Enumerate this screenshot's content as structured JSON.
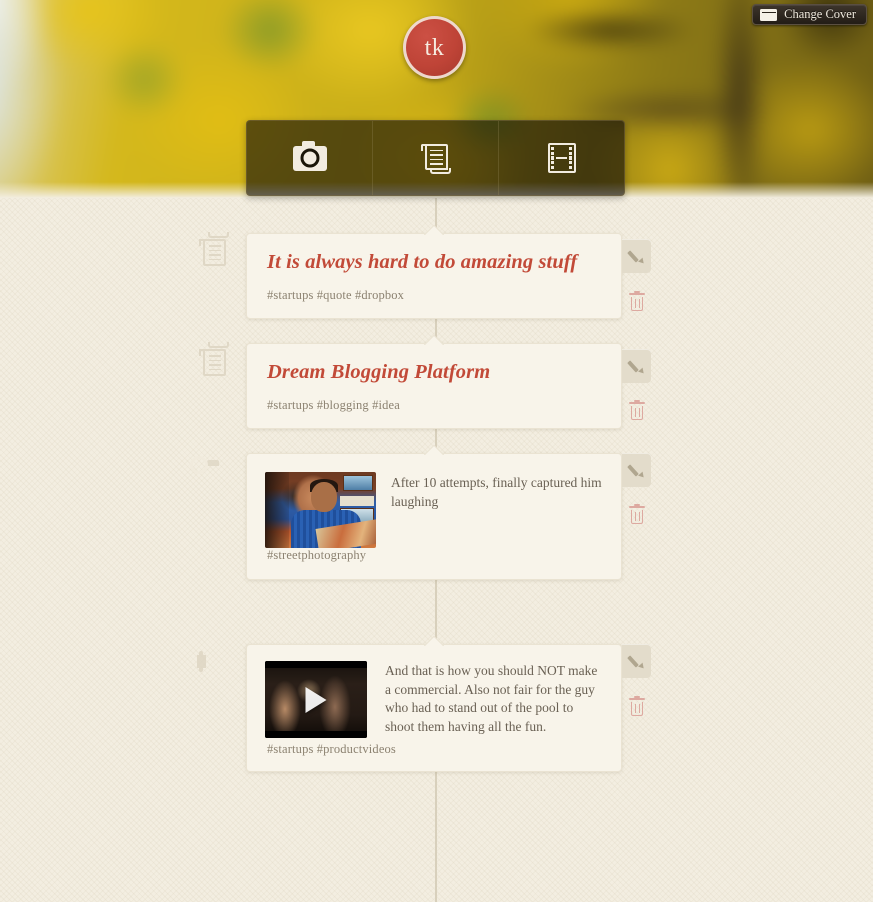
{
  "cover": {
    "change_cover_label": "Change Cover",
    "change_cover_icon": "image-icon"
  },
  "profile": {
    "avatar_initials": "tk",
    "avatar_color": "#bf4437"
  },
  "composer": {
    "buttons": [
      {
        "name": "photo",
        "icon": "camera-icon"
      },
      {
        "name": "note",
        "icon": "scroll-icon"
      },
      {
        "name": "video",
        "icon": "film-icon"
      }
    ]
  },
  "actions": {
    "edit_icon": "pencil-icon",
    "delete_icon": "trash-icon"
  },
  "posts": [
    {
      "type": "note",
      "type_icon": "scroll-icon",
      "title": "It is always hard to do amazing stuff",
      "tags": "#startups  #quote  #dropbox"
    },
    {
      "type": "note",
      "type_icon": "scroll-icon",
      "title": "Dream Blogging Platform",
      "tags": "#startups  #blogging  #idea"
    },
    {
      "type": "photo",
      "type_icon": "camera-icon",
      "caption": "After 10 attempts, finally captured him laughing",
      "tags": "#streetphotography"
    },
    {
      "type": "video",
      "type_icon": "film-icon",
      "caption": "And that is how you should NOT make a commercial. Also not fair for the guy who had to stand out of the pool to shoot them having all the fun.",
      "tags": "#startups #productvideos",
      "play_icon": "play-icon"
    }
  ],
  "theme": {
    "page_bg": "#f3eee1",
    "card_bg": "#f8f4ea",
    "title_color": "#c24a38",
    "tag_color": "#8c8271",
    "caption_color": "#6a6154",
    "timeline_color": "#d8d0bc",
    "delete_color": "#dda9a0"
  }
}
